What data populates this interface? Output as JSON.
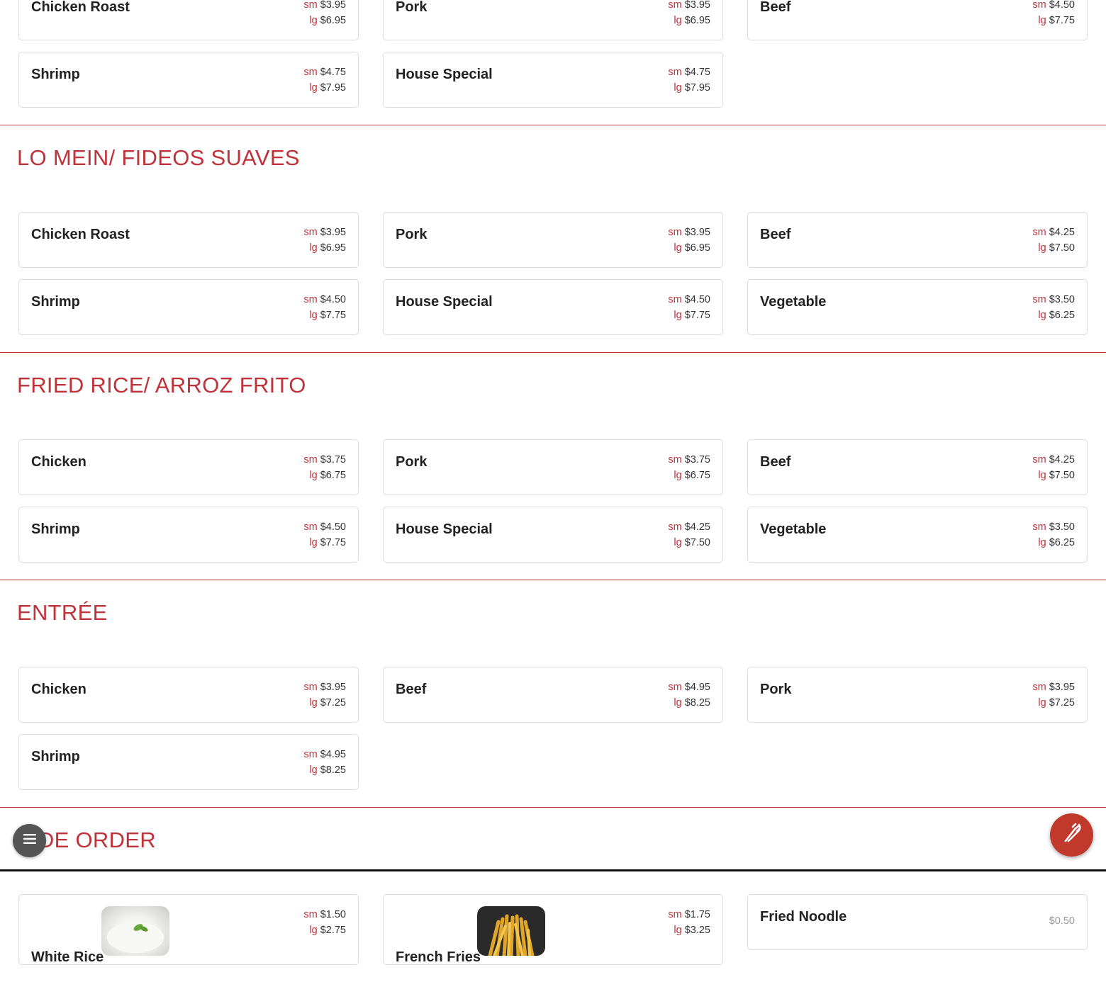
{
  "sections": [
    {
      "title": "",
      "items": [
        {
          "name": "Chicken Roast",
          "sm": "$3.95",
          "lg": "$6.95"
        },
        {
          "name": "Pork",
          "sm": "$3.95",
          "lg": "$6.95"
        },
        {
          "name": "Beef",
          "sm": "$4.50",
          "lg": "$7.75"
        },
        {
          "name": "Shrimp",
          "sm": "$4.75",
          "lg": "$7.95"
        },
        {
          "name": "House Special",
          "sm": "$4.75",
          "lg": "$7.95"
        }
      ]
    },
    {
      "title": "LO MEIN/ FIDEOS SUAVES",
      "items": [
        {
          "name": "Chicken Roast",
          "sm": "$3.95",
          "lg": "$6.95"
        },
        {
          "name": "Pork",
          "sm": "$3.95",
          "lg": "$6.95"
        },
        {
          "name": "Beef",
          "sm": "$4.25",
          "lg": "$7.50"
        },
        {
          "name": "Shrimp",
          "sm": "$4.50",
          "lg": "$7.75"
        },
        {
          "name": "House Special",
          "sm": "$4.50",
          "lg": "$7.75"
        },
        {
          "name": "Vegetable",
          "sm": "$3.50",
          "lg": "$6.25"
        }
      ]
    },
    {
      "title": "FRIED RICE/ ARROZ FRITO",
      "items": [
        {
          "name": "Chicken",
          "sm": "$3.75",
          "lg": "$6.75"
        },
        {
          "name": "Pork",
          "sm": "$3.75",
          "lg": "$6.75"
        },
        {
          "name": "Beef",
          "sm": "$4.25",
          "lg": "$7.50"
        },
        {
          "name": "Shrimp",
          "sm": "$4.50",
          "lg": "$7.75"
        },
        {
          "name": "House Special",
          "sm": "$4.25",
          "lg": "$7.50"
        },
        {
          "name": "Vegetable",
          "sm": "$3.50",
          "lg": "$6.25"
        }
      ]
    },
    {
      "title": "ENTRÉE",
      "items": [
        {
          "name": "Chicken",
          "sm": "$3.95",
          "lg": "$7.25"
        },
        {
          "name": "Beef",
          "sm": "$4.95",
          "lg": "$8.25"
        },
        {
          "name": "Pork",
          "sm": "$3.95",
          "lg": "$7.25"
        },
        {
          "name": "Shrimp",
          "sm": "$4.95",
          "lg": "$8.25"
        }
      ]
    },
    {
      "title": "SIDE ORDER",
      "items": [
        {
          "name": "White Rice",
          "sm": "$1.50",
          "lg": "$2.75",
          "image": "white-rice-photo"
        },
        {
          "name": "French Fries",
          "sm": "$1.75",
          "lg": "$3.25",
          "image": "french-fries-photo"
        },
        {
          "name": "Fried Noodle",
          "price": "$0.50"
        }
      ]
    }
  ],
  "labels": {
    "sm": "sm",
    "lg": "lg"
  },
  "fab": {
    "menu_icon": "hamburger-menu-icon",
    "order_icon": "fork-knife-icon"
  },
  "colors": {
    "accent": "#c0323a",
    "order_button": "#c0392b",
    "menu_button": "#555555"
  }
}
